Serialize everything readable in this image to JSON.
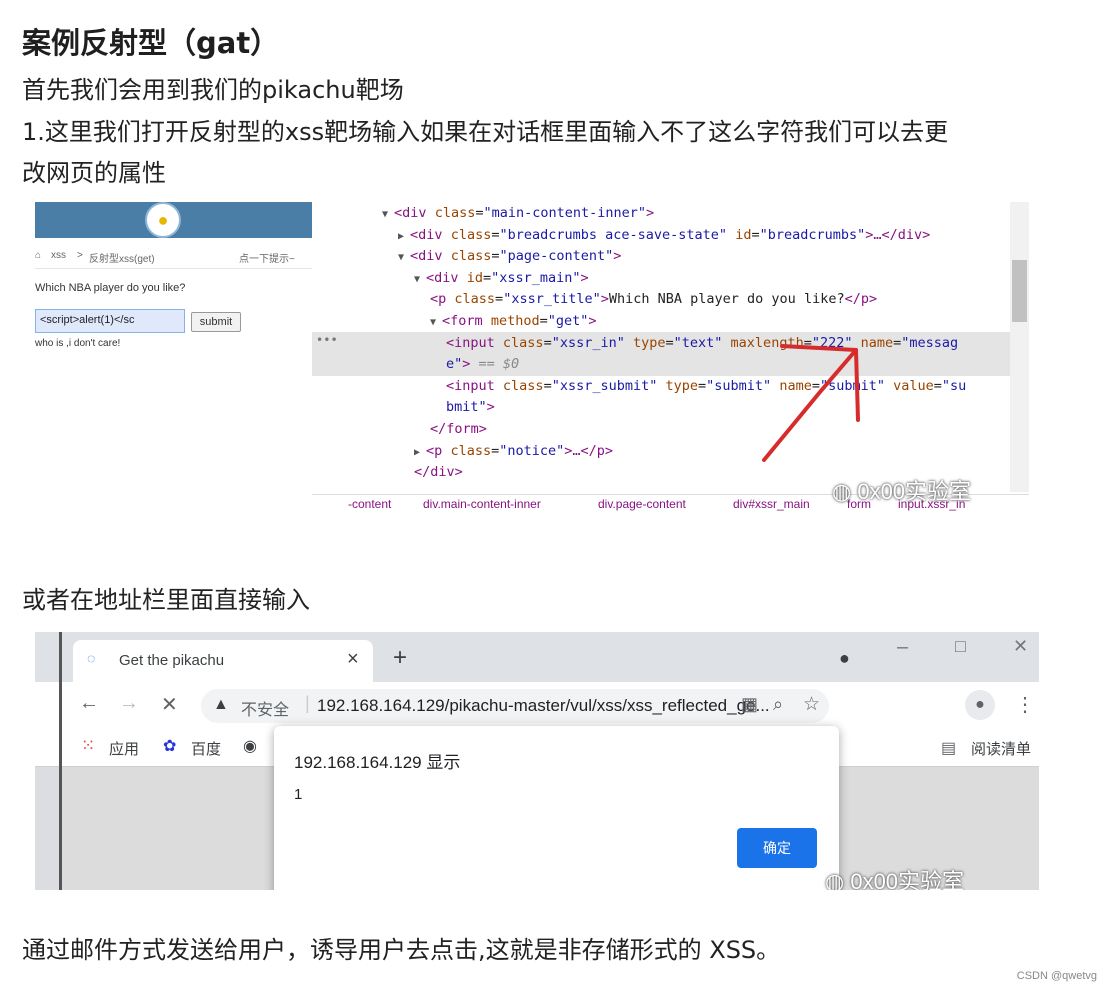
{
  "heading": "案例反射型（gat）",
  "paragraphs": {
    "p1": "首先我们会用到我们的pikachu靶场",
    "p2_line1": "1.这里我们打开反射型的xss靶场输入如果在对话框里面输入不了这么字符我们可以去更",
    "p2_line2": "改网页的属性",
    "p3": "或者在地址栏里面直接输入",
    "p4": "通过邮件方式发送给用户，诱导用户去点击,这就是非存储形式的 XSS。"
  },
  "screenshot1": {
    "pikachu": {
      "breadcrumb_home": "xss",
      "breadcrumb_sep": ">",
      "breadcrumb_page": "反射型xss(get)",
      "hint": "点一下提示~",
      "question": "Which NBA player do you like?",
      "input_value": "<script>alert(1)</sc",
      "submit_label": "submit",
      "note": "who is ,i don't care!"
    },
    "devtools": {
      "lines": [
        {
          "tri": "▼",
          "tag_open": "<div",
          "attrs": [
            {
              "n": "class",
              "v": "\"main-content-inner\""
            }
          ],
          "tail": ">"
        },
        {
          "tri": "▶",
          "tag_open": "<div",
          "attrs": [
            {
              "n": "class",
              "v": "\"breadcrumbs ace-save-state\""
            },
            {
              "n": "id",
              "v": "\"breadcrumbs\""
            }
          ],
          "tail": ">…</div>"
        },
        {
          "tri": "▼",
          "tag_open": "<div",
          "attrs": [
            {
              "n": "class",
              "v": "\"page-content\""
            }
          ],
          "tail": ">"
        },
        {
          "tri": "▼",
          "tag_open": "<div",
          "attrs": [
            {
              "n": "id",
              "v": "\"xssr_main\""
            }
          ],
          "tail": ">"
        },
        {
          "tri": "",
          "tag_open": "<p",
          "attrs": [
            {
              "n": "class",
              "v": "\"xssr_title\""
            }
          ],
          "tail": ">",
          "text": "Which NBA player do you like?",
          "close": "</p>"
        },
        {
          "tri": "▼",
          "tag_open": "<form",
          "attrs": [
            {
              "n": "method",
              "v": "\"get\""
            }
          ],
          "tail": ">"
        },
        {
          "tri": "",
          "tag_open": "<input",
          "attrs": [
            {
              "n": "class",
              "v": "\"xssr_in\""
            },
            {
              "n": "type",
              "v": "\"text\""
            },
            {
              "n": "maxlength",
              "v": "\"222\""
            },
            {
              "n": "name",
              "v": "\"messag"
            }
          ],
          "tail": ""
        },
        {
          "tri": "",
          "tag_open": "",
          "attrs": [
            {
              "n": "",
              "v": "e\""
            }
          ],
          "tail": ">",
          "extra": " == $0"
        },
        {
          "tri": "",
          "tag_open": "<input",
          "attrs": [
            {
              "n": "class",
              "v": "\"xssr_submit\""
            },
            {
              "n": "type",
              "v": "\"submit\""
            },
            {
              "n": "name",
              "v": "\"submit\""
            },
            {
              "n": "value",
              "v": "\"su"
            }
          ],
          "tail": ""
        },
        {
          "tri": "",
          "tag_open": "",
          "attrs": [
            {
              "n": "",
              "v": "bmit\""
            }
          ],
          "tail": ">"
        },
        {
          "tri": "",
          "tag_open": "</form>",
          "attrs": [],
          "tail": ""
        },
        {
          "tri": "▶",
          "tag_open": "<p",
          "attrs": [
            {
              "n": "class",
              "v": "\"notice\""
            }
          ],
          "tail": ">…</p>"
        },
        {
          "tri": "",
          "tag_open": "</div>",
          "attrs": [],
          "tail": ""
        }
      ],
      "selected_marker": "•••",
      "breadcrumb_tabs": [
        "-content",
        "div.main-content-inner",
        "div.page-content",
        "div#xssr_main",
        "form",
        "input.xssr_in"
      ]
    },
    "watermark": "0x00实验室"
  },
  "screenshot2": {
    "tab_title": "Get the pikachu",
    "tab_close": "×",
    "new_tab": "+",
    "not_secure": "不安全",
    "url": "192.168.164.129/pikachu-master/vul/xss/xss_reflected_ge...",
    "bookmarks": [
      {
        "icon": "apps-icon",
        "label": "应用"
      },
      {
        "icon": "baidu-icon",
        "label": "百度"
      }
    ],
    "reading_list": "阅读清单",
    "dialog": {
      "title": "192.168.164.129 显示",
      "message": "1",
      "ok_label": "确定"
    },
    "watermark": "0x00实验室"
  },
  "footer": "CSDN @qwetvg",
  "colors": {
    "pikachu_header": "#4a7ea6",
    "devtools_tag": "#881280",
    "devtools_attr_name": "#994500",
    "devtools_attr_value": "#1a1aa6",
    "dialog_button": "#1a73e8",
    "annotation_arrow": "#d62c2c"
  }
}
